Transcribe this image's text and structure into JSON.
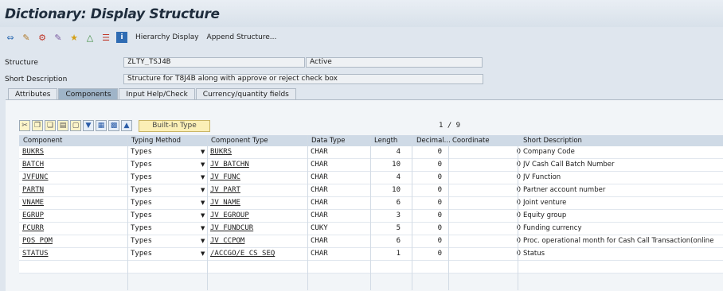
{
  "window": {
    "title": "Dictionary: Display Structure"
  },
  "toolbar": {
    "icons": [
      "back-icon",
      "other-object-icon",
      "display-change-icon",
      "check-icon",
      "activate-icon",
      "where-used-icon",
      "hierarchy-icon",
      "info-icon"
    ],
    "hierarchy_label": "Hierarchy Display",
    "append_label": "Append Structure..."
  },
  "header": {
    "structure_label": "Structure",
    "structure_value": "ZLTY_TSJ4B",
    "status": "Active",
    "short_desc_label": "Short Description",
    "short_desc_value": "Structure for T8J4B along with approve or reject check box"
  },
  "tabs": [
    {
      "label": "Attributes",
      "active": false
    },
    {
      "label": "Components",
      "active": true
    },
    {
      "label": "Input Help/Check",
      "active": false
    },
    {
      "label": "Currency/quantity fields",
      "active": false
    }
  ],
  "grid_toolbar": {
    "builtin_label": "Built-In Type",
    "pager": "1 / 9"
  },
  "table": {
    "columns": [
      "Component",
      "Typing Method",
      "Component Type",
      "Data Type",
      "Length",
      "Decimal...",
      "Coordinate",
      "Short Description"
    ],
    "rows": [
      {
        "component": "BUKRS",
        "typing": "Types",
        "ctype": "BUKRS",
        "dtype": "CHAR",
        "length": "4",
        "decimals": "0",
        "coord": "0",
        "desc": "Company Code"
      },
      {
        "component": "BATCH",
        "typing": "Types",
        "ctype": "JV_BATCHN",
        "dtype": "CHAR",
        "length": "10",
        "decimals": "0",
        "coord": "0",
        "desc": "JV Cash Call Batch Number"
      },
      {
        "component": "JVFUNC",
        "typing": "Types",
        "ctype": "JV_FUNC",
        "dtype": "CHAR",
        "length": "4",
        "decimals": "0",
        "coord": "0",
        "desc": "JV Function"
      },
      {
        "component": "PARTN",
        "typing": "Types",
        "ctype": "JV_PART",
        "dtype": "CHAR",
        "length": "10",
        "decimals": "0",
        "coord": "0",
        "desc": "Partner account number"
      },
      {
        "component": "VNAME",
        "typing": "Types",
        "ctype": "JV_NAME",
        "dtype": "CHAR",
        "length": "6",
        "decimals": "0",
        "coord": "0",
        "desc": "Joint venture"
      },
      {
        "component": "EGRUP",
        "typing": "Types",
        "ctype": "JV_EGROUP",
        "dtype": "CHAR",
        "length": "3",
        "decimals": "0",
        "coord": "0",
        "desc": "Equity group"
      },
      {
        "component": "FCURR",
        "typing": "Types",
        "ctype": "JV_FUNDCUR",
        "dtype": "CUKY",
        "length": "5",
        "decimals": "0",
        "coord": "0",
        "desc": "Funding currency"
      },
      {
        "component": "POS_POM",
        "typing": "Types",
        "ctype": "JV_CCPOM",
        "dtype": "CHAR",
        "length": "6",
        "decimals": "0",
        "coord": "0",
        "desc": "Proc. operational month for Cash Call Transaction(online"
      },
      {
        "component": "STATUS",
        "typing": "Types",
        "ctype": "/ACCGO/E_CS_SEQ",
        "dtype": "CHAR",
        "length": "1",
        "decimals": "0",
        "coord": "0",
        "desc": "Status"
      }
    ]
  }
}
